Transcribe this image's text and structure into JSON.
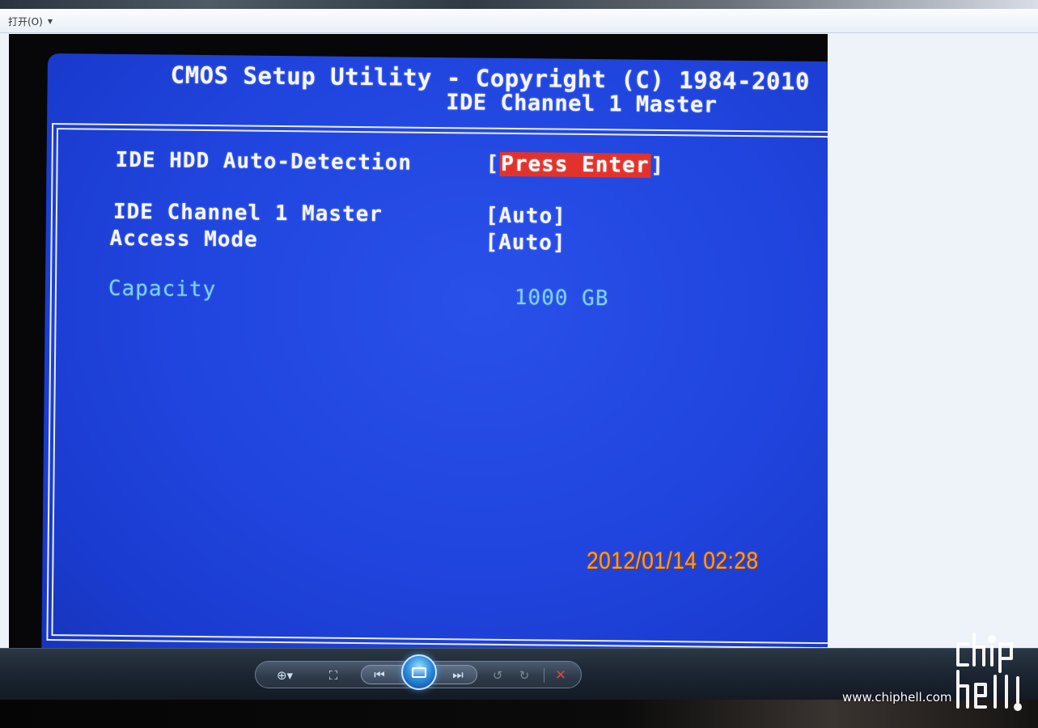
{
  "menubar": {
    "open_label": "打开(O)",
    "open_caret": "▼"
  },
  "bios": {
    "title": "CMOS Setup Utility - Copyright (C) 1984-2010",
    "subtitle": "IDE Channel 1 Master",
    "options": [
      {
        "label": "IDE HDD Auto-Detection",
        "value_open": "[",
        "value": "Press Enter",
        "value_close": "]",
        "selected": true
      },
      {
        "label": "IDE Channel 1 Master",
        "value": "[Auto]"
      },
      {
        "label": "Access Mode",
        "value": "[Auto]"
      }
    ],
    "info": {
      "label": "Capacity",
      "value": "1000 GB"
    }
  },
  "photo": {
    "timestamp": "2012/01/14  02:28"
  },
  "toolbar": {
    "zoom_icon": "⊕▾",
    "fit_icon": "⛶",
    "prev_icon": "⏮",
    "next_icon": "⏭",
    "rotate_ccw_icon": "↺",
    "rotate_cw_icon": "↻",
    "delete_icon": "✕"
  },
  "watermark": {
    "url": "www.chiphell.com",
    "logo_text": "chip hell"
  },
  "colors": {
    "bios_blue": "#2146e0",
    "highlight_red": "#e3322c",
    "info_cyan": "#7fd0f0",
    "timestamp_orange": "#ff9a2c"
  }
}
